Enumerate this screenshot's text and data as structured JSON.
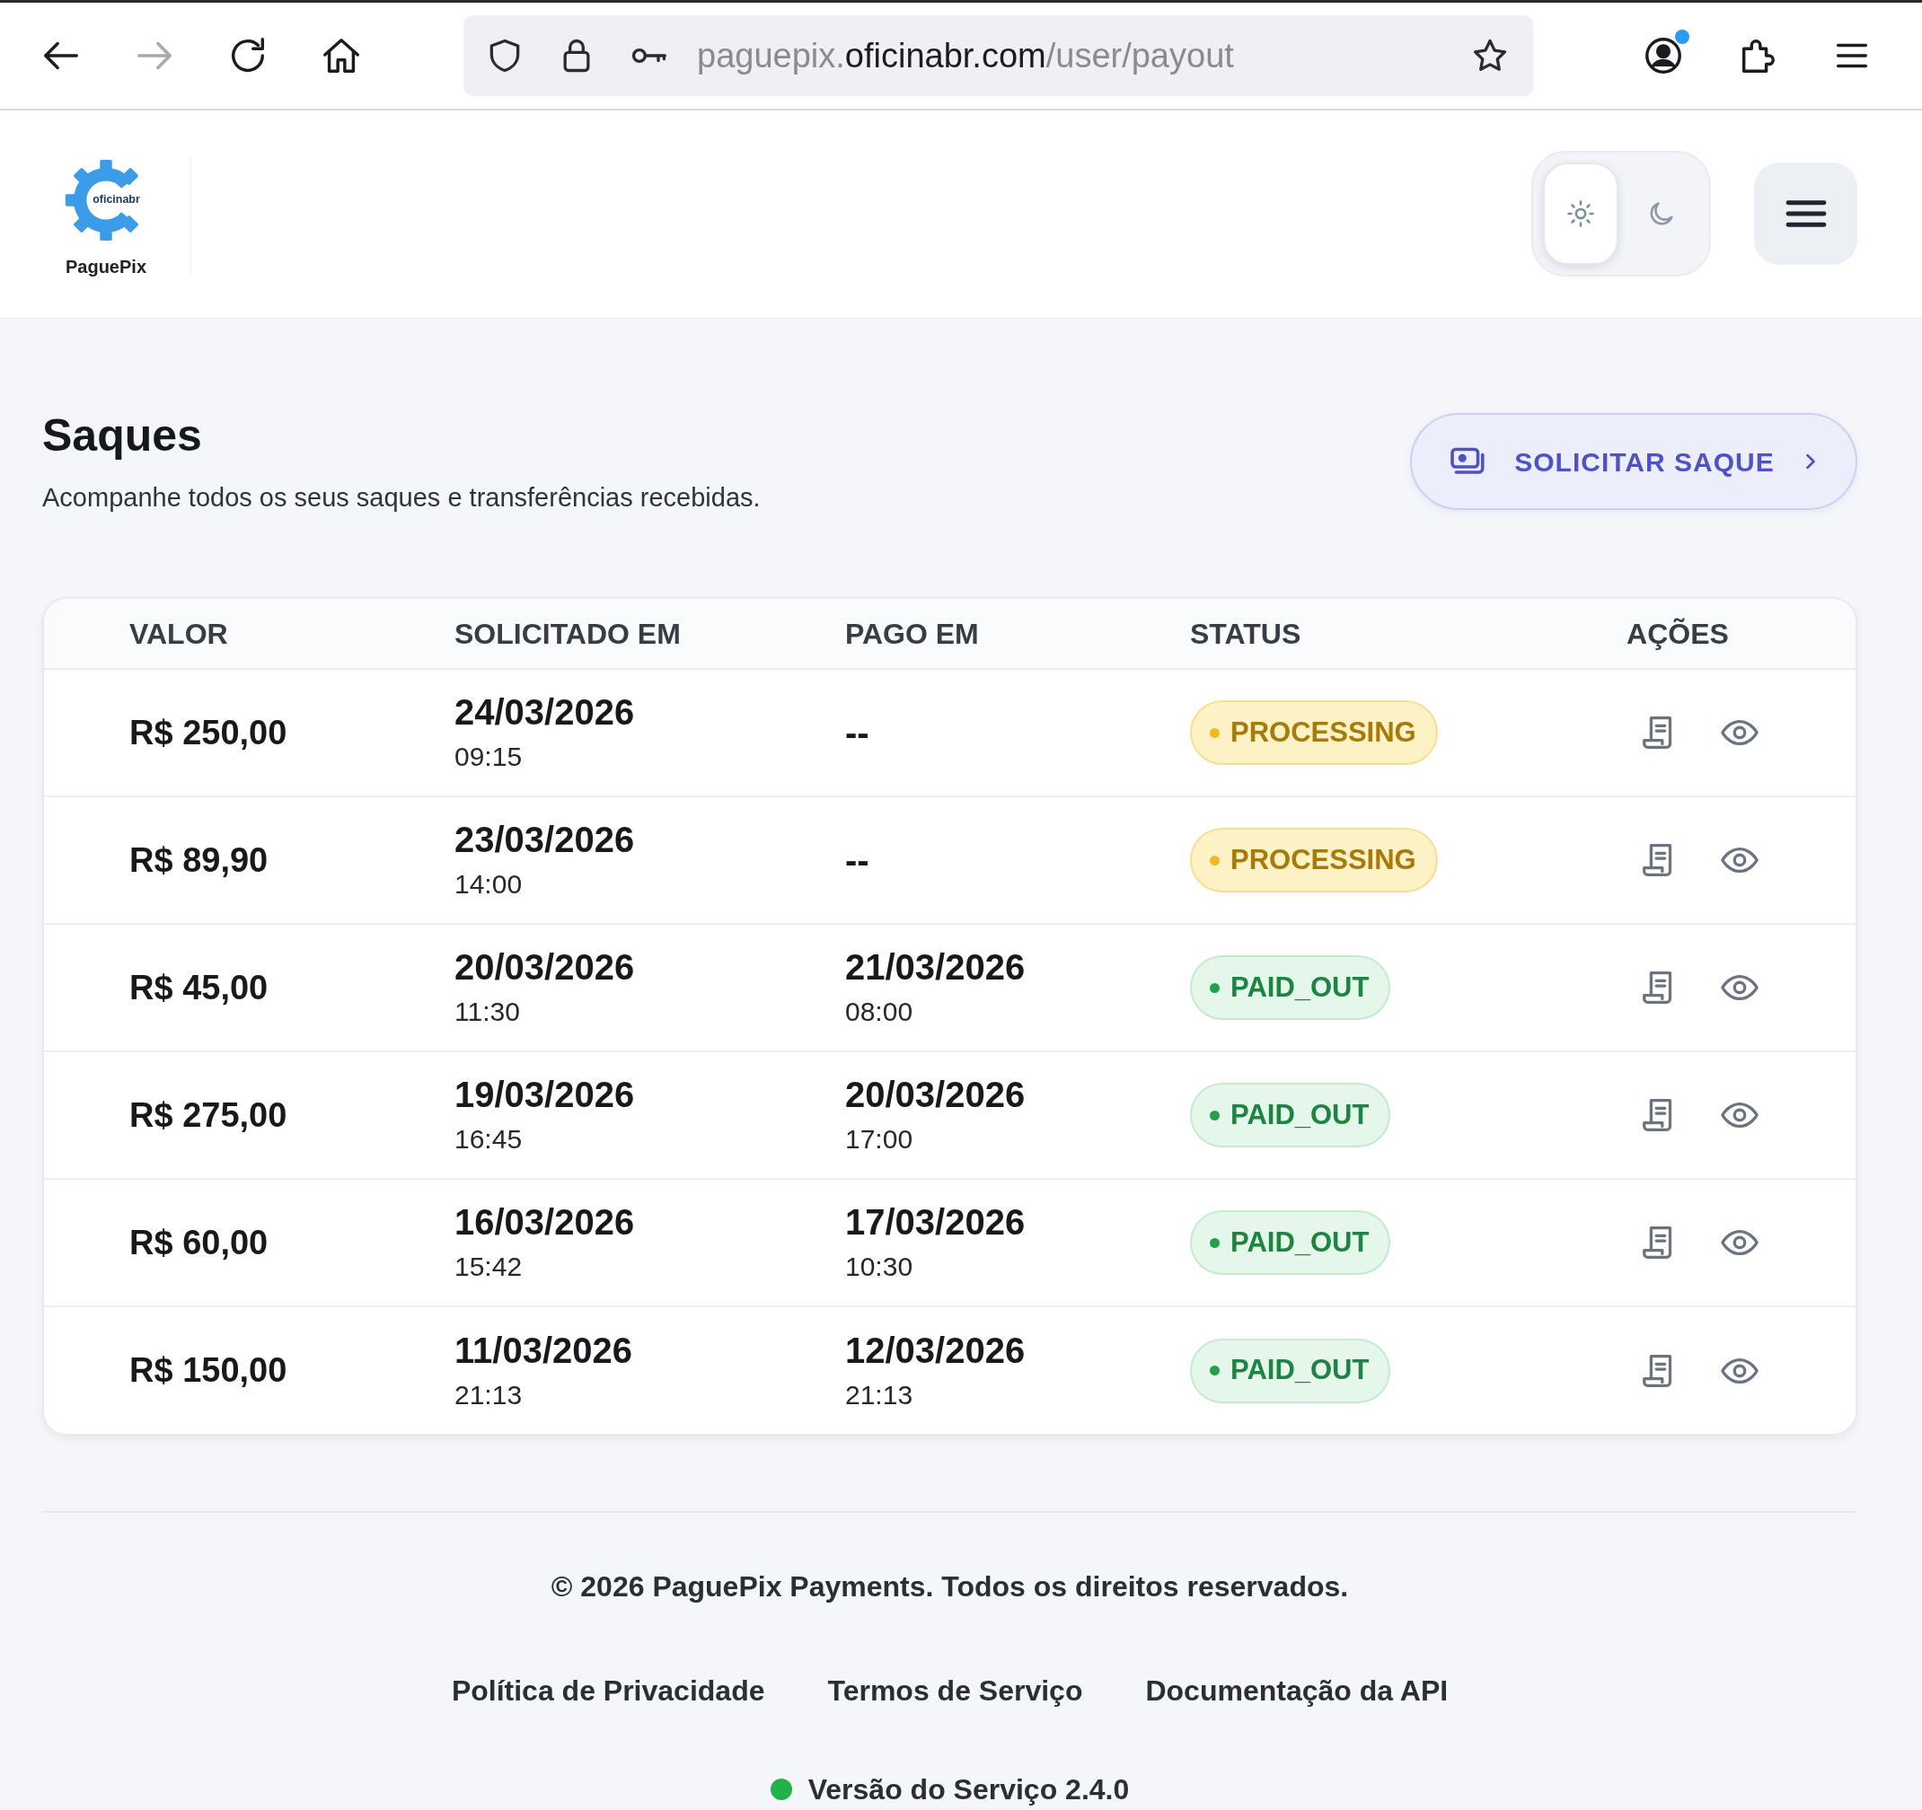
{
  "browser": {
    "nav_buttons": [
      {
        "kind": "back",
        "disabled": false
      },
      {
        "kind": "forward",
        "disabled": true
      },
      {
        "kind": "reload",
        "disabled": false
      },
      {
        "kind": "home",
        "disabled": false
      }
    ],
    "address_bar": {
      "url_start": "paguepix.",
      "url_host": "oficinabr.com",
      "url_path": "/user/payout"
    },
    "account": {
      "notification": true
    }
  },
  "header": {
    "logo": {
      "mark_text": "oficinabr",
      "name": "PaguePix"
    },
    "theme_toggle": [
      {
        "kind": "light",
        "selected": true
      },
      {
        "kind": "dark",
        "selected": false
      }
    ]
  },
  "page": {
    "title": "Saques",
    "subtitle": "Acompanhe todos os seus saques e transferências recebidas.",
    "action_button": "SOLICITAR SAQUE"
  },
  "table": {
    "columns": [
      "VALOR",
      "SOLICITADO EM",
      "PAGO EM",
      "STATUS",
      "AÇÕES"
    ],
    "rows": [
      {
        "amount": "R$ 250,00",
        "requested_date": "24/03/2026",
        "requested_time": "09:15",
        "paid_date": "--",
        "status": {
          "text": "PROCESSING",
          "kind": "processing"
        }
      },
      {
        "amount": "R$ 89,90",
        "requested_date": "23/03/2026",
        "requested_time": "14:00",
        "paid_date": "--",
        "status": {
          "text": "PROCESSING",
          "kind": "processing"
        }
      },
      {
        "amount": "R$ 45,00",
        "requested_date": "20/03/2026",
        "requested_time": "11:30",
        "paid_date": "21/03/2026",
        "paid_time": "08:00",
        "status": {
          "text": "PAID_OUT",
          "kind": "paid"
        }
      },
      {
        "amount": "R$ 275,00",
        "requested_date": "19/03/2026",
        "requested_time": "16:45",
        "paid_date": "20/03/2026",
        "paid_time": "17:00",
        "status": {
          "text": "PAID_OUT",
          "kind": "paid"
        }
      },
      {
        "amount": "R$ 60,00",
        "requested_date": "16/03/2026",
        "requested_time": "15:42",
        "paid_date": "17/03/2026",
        "paid_time": "10:30",
        "status": {
          "text": "PAID_OUT",
          "kind": "paid"
        }
      },
      {
        "amount": "R$ 150,00",
        "requested_date": "11/03/2026",
        "requested_time": "21:13",
        "paid_date": "12/03/2026",
        "paid_time": "21:13",
        "status": {
          "text": "PAID_OUT",
          "kind": "paid"
        }
      }
    ]
  },
  "footer": {
    "copyright": "© 2026 PaguePix Payments. Todos os direitos reservados.",
    "links": [
      "Política de Privacidade",
      "Termos de Serviço",
      "Documentação da API"
    ],
    "version": {
      "text": "Versão do Serviço 2.4.0",
      "online": true
    }
  }
}
